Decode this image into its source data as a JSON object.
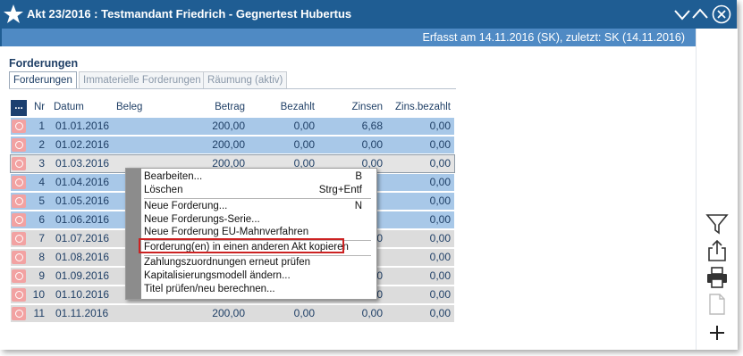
{
  "window": {
    "title": "Akt 23/2016 : Testmandant Friedrich - Gegnertest Hubertus",
    "info": "Erfasst am 14.11.2016 (SK), zuletzt: SK (14.11.2016)"
  },
  "section": {
    "title": "Forderungen"
  },
  "tabs": [
    {
      "label": "Forderungen"
    },
    {
      "label": "Immaterielle Forderungen"
    },
    {
      "label": "Räumung (aktiv)"
    }
  ],
  "grid": {
    "dots": "...",
    "columns": {
      "nr": "Nr",
      "datum": "Datum",
      "beleg": "Beleg",
      "betrag": "Betrag",
      "bezahlt": "Bezahlt",
      "zinsen": "Zinsen",
      "zinsbezahlt": "Zins.bezahlt"
    },
    "rows": [
      {
        "nr": "1",
        "datum": "01.01.2016",
        "betrag": "200,00",
        "bezahlt": "0,00",
        "zinsen": "6,68",
        "zinsbezahlt": "0,00"
      },
      {
        "nr": "2",
        "datum": "01.02.2016",
        "betrag": "200,00",
        "bezahlt": "0,00",
        "zinsen": "0,00",
        "zinsbezahlt": "0,00"
      },
      {
        "nr": "3",
        "datum": "01.03.2016",
        "betrag": "200,00",
        "bezahlt": "0,00",
        "zinsen": "0,00",
        "zinsbezahlt": "0,00"
      },
      {
        "nr": "4",
        "datum": "01.04.2016",
        "betrag": "",
        "bezahlt": "",
        "zinsen": "",
        "zinsbezahlt": "0,00"
      },
      {
        "nr": "5",
        "datum": "01.05.2016",
        "betrag": "",
        "bezahlt": "",
        "zinsen": "",
        "zinsbezahlt": "0,00"
      },
      {
        "nr": "6",
        "datum": "01.06.2016",
        "betrag": "",
        "bezahlt": "",
        "zinsen": "",
        "zinsbezahlt": "0,00"
      },
      {
        "nr": "7",
        "datum": "01.07.2016",
        "betrag": "",
        "bezahlt": "",
        "zinsen": "0",
        "zinsbezahlt": "0,00"
      },
      {
        "nr": "8",
        "datum": "01.08.2016",
        "betrag": "",
        "bezahlt": "",
        "zinsen": "",
        "zinsbezahlt": "0,00"
      },
      {
        "nr": "9",
        "datum": "01.09.2016",
        "betrag": "",
        "bezahlt": "",
        "zinsen": "0",
        "zinsbezahlt": "0,00"
      },
      {
        "nr": "10",
        "datum": "01.10.2016",
        "betrag": "",
        "bezahlt": "",
        "zinsen": "0",
        "zinsbezahlt": "0,00"
      },
      {
        "nr": "11",
        "datum": "01.11.2016",
        "betrag": "200,00",
        "bezahlt": "0,00",
        "zinsen": "0,00",
        "zinsbezahlt": "0,00"
      }
    ]
  },
  "context_menu": {
    "items": [
      {
        "label": "Bearbeiten...",
        "shortcut": "B"
      },
      {
        "label": "Löschen",
        "shortcut": "Strg+Entf"
      },
      {
        "label": "Neue Forderung...",
        "shortcut": "N"
      },
      {
        "label": "Neue Forderungs-Serie...",
        "shortcut": ""
      },
      {
        "label": "Neue Forderung EU-Mahnverfahren",
        "shortcut": ""
      },
      {
        "label": "Forderung(en) in einen anderen Akt kopieren",
        "shortcut": ""
      },
      {
        "label": "Zahlungszuordnungen erneut prüfen",
        "shortcut": ""
      },
      {
        "label": "Kapitalisierungsmodell ändern...",
        "shortcut": ""
      },
      {
        "label": "Titel prüfen/neu berechnen...",
        "shortcut": ""
      }
    ]
  },
  "icons": [
    "star-icon",
    "minimize-icon",
    "maximize-icon",
    "close-icon",
    "filter-icon",
    "export-icon",
    "print-icon",
    "document-icon",
    "add-icon",
    "claim-row-icon"
  ],
  "colors": {
    "titlebar": "#1f5d93",
    "infobar": "#4f8ac4",
    "selected_row": "#a8c8e8",
    "highlight": "#cc2222"
  }
}
